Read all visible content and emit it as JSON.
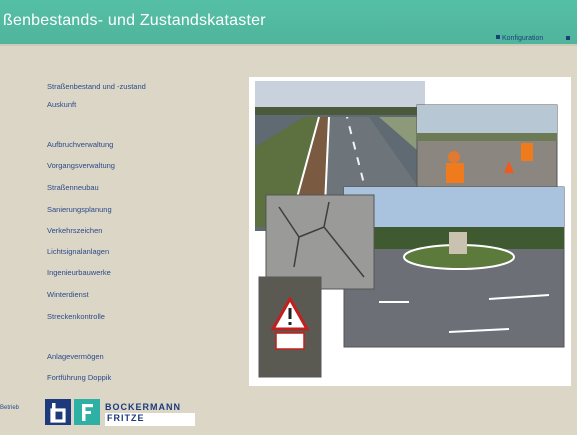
{
  "header": {
    "title": "ßenbestands- und Zustandskataster",
    "link_label": "Konfiguration"
  },
  "nav": {
    "items": [
      {
        "label": "Straßenbestand und -zustand"
      },
      {
        "label": "Auskunft"
      },
      {
        "label": "Aufbruchverwaltung"
      },
      {
        "label": "Vorgangsverwaltung"
      },
      {
        "label": "Straßenneubau"
      },
      {
        "label": "Sanierungsplanung"
      },
      {
        "label": "Verkehrszeichen"
      },
      {
        "label": "Lichtsignalanlagen"
      },
      {
        "label": "Ingenieurbauwerke"
      },
      {
        "label": "Winterdienst"
      },
      {
        "label": "Streckenkontrolle"
      },
      {
        "label": "Anlagevermögen"
      },
      {
        "label": "Fortführung Doppik"
      }
    ]
  },
  "footer": {
    "label": "Betrieb",
    "logo_line1": "BOCKERMANN",
    "logo_line2": "FRITZE"
  },
  "colors": {
    "header": "#52bba2",
    "background": "#dcd6c6",
    "link": "#2b4a8a",
    "logo_dark": "#1c3a7c",
    "logo_teal": "#2fb0a5"
  }
}
